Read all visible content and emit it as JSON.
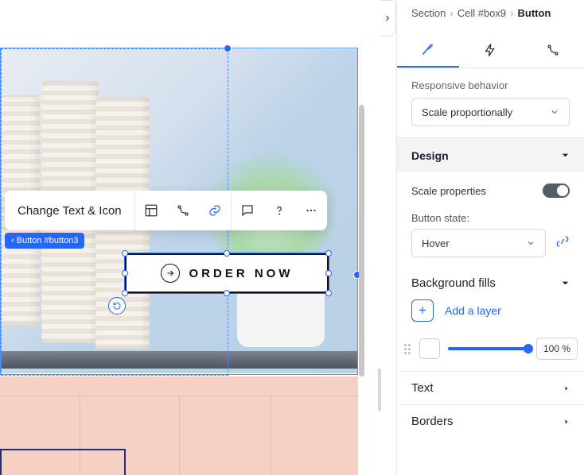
{
  "breadcrumb": {
    "a": "Section",
    "b": "Cell #box9",
    "c": "Button"
  },
  "tabs": {
    "design": "design",
    "triggers": "triggers",
    "interactions": "interactions"
  },
  "responsive": {
    "label": "Responsive behavior",
    "value": "Scale proportionally"
  },
  "designHead": "Design",
  "scaleProps": "Scale properties",
  "buttonState": {
    "label": "Button state:",
    "value": "Hover"
  },
  "bgFills": {
    "head": "Background fills",
    "add": "Add a layer",
    "opacity": "100 %"
  },
  "textHead": "Text",
  "bordersHead": "Borders",
  "toolbar": {
    "changeText": "Change Text & Icon"
  },
  "tagBadge": "Button #button3",
  "orderButton": {
    "label": "ORDER NOW"
  }
}
